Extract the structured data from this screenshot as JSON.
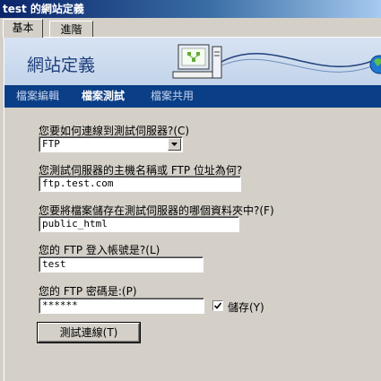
{
  "window": {
    "title": "test 的網站定義"
  },
  "tabs": [
    {
      "label": "基本",
      "active": true
    },
    {
      "label": "進階",
      "active": false
    }
  ],
  "banner": {
    "title": "網站定義",
    "illustration_icon": "computer-network-icon"
  },
  "nav": [
    {
      "label": "檔案編輯",
      "active": false
    },
    {
      "label": "檔案測試",
      "active": true
    },
    {
      "label": "檔案共用",
      "active": false
    }
  ],
  "form": {
    "connect_label": "您要如何連線到測試伺服器?(C)",
    "connect_value": "FTP",
    "host_label": "您測試伺服器的主機名稱或 FTP 位址為何?",
    "host_value": "ftp.test.com",
    "folder_label": "您要將檔案儲存在測試伺服器的哪個資料夾中?(F)",
    "folder_value": "public_html",
    "login_label": "您的 FTP 登入帳號是?(L)",
    "login_value": "test",
    "password_label": "您的 FTP 密碼是:(P)",
    "password_value": "******",
    "save_checkbox_label": "儲存(Y)",
    "save_checked": true,
    "test_button_label": "測試連線(T)"
  },
  "colors": {
    "navbar": "#0a3e86",
    "titlebar": "#0a246a",
    "banner": "#c3d4ea"
  }
}
